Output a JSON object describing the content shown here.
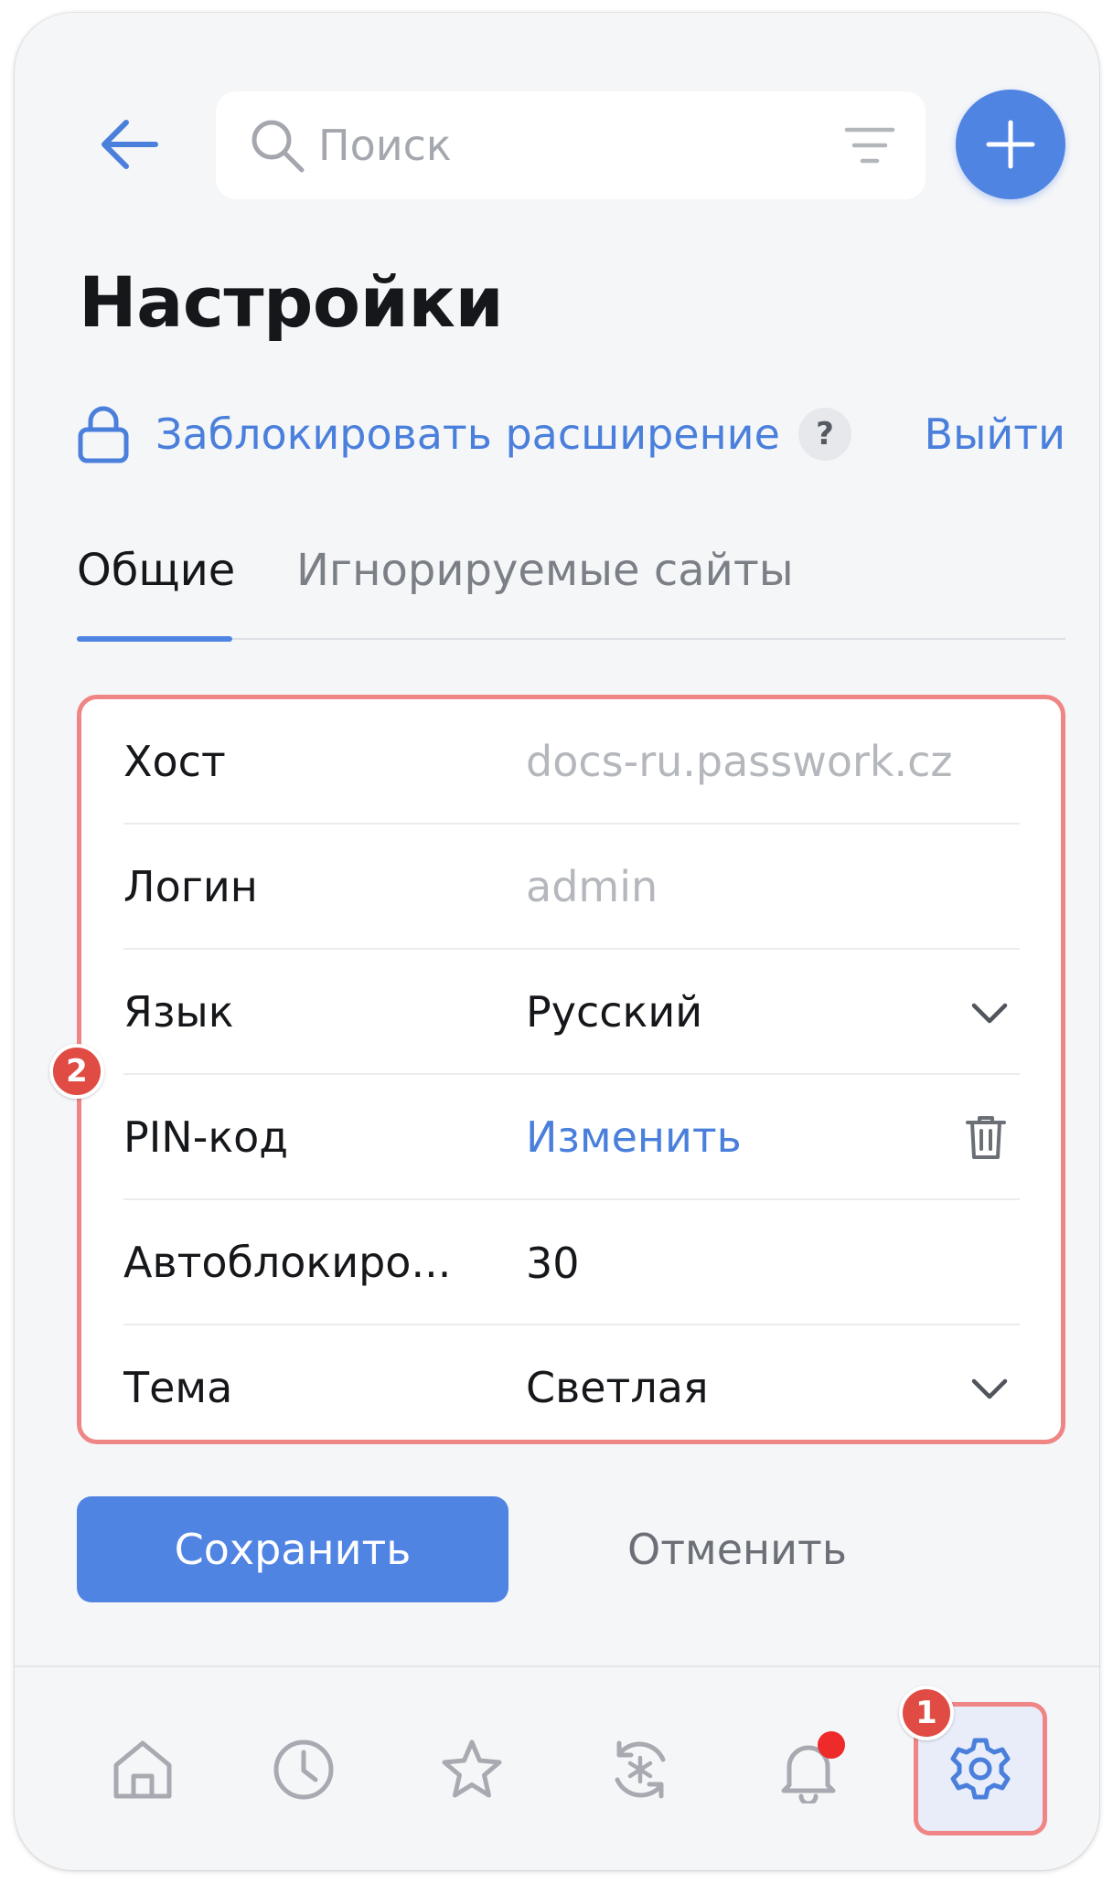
{
  "header": {
    "search_placeholder": "Поиск"
  },
  "page": {
    "title": "Настройки"
  },
  "actions": {
    "lock_extension_label": "Заблокировать расширение",
    "help_label": "?",
    "logout_label": "Выйти"
  },
  "tabs": [
    {
      "label": "Общие",
      "active": true
    },
    {
      "label": "Игнорируемые сайты",
      "active": false
    }
  ],
  "settings": {
    "host": {
      "label": "Хост",
      "value": "docs-ru.passwork.cz"
    },
    "login": {
      "label": "Логин",
      "value": "admin"
    },
    "language": {
      "label": "Язык",
      "value": "Русский"
    },
    "pin": {
      "label": "PIN-код",
      "value": "Изменить"
    },
    "autolock": {
      "label": "Автоблокиро...",
      "value": "30"
    },
    "theme": {
      "label": "Тема",
      "value": "Светлая"
    }
  },
  "buttons": {
    "save_label": "Сохранить",
    "cancel_label": "Отменить"
  },
  "badges": {
    "settings_nav": "1",
    "settings_card": "2"
  },
  "bottom_nav": [
    {
      "icon": "home-icon"
    },
    {
      "icon": "clock-icon"
    },
    {
      "icon": "star-icon"
    },
    {
      "icon": "password-generator-icon"
    },
    {
      "icon": "bell-icon",
      "has_notification": true
    },
    {
      "icon": "gear-icon",
      "active": true
    }
  ],
  "colors": {
    "accent": "#4f84e3",
    "link": "#4a7fdc",
    "highlight_border": "#ef8585",
    "badge": "#e04b43",
    "notification_dot": "#ef2a2a",
    "panel_background": "#f5f6f8"
  }
}
